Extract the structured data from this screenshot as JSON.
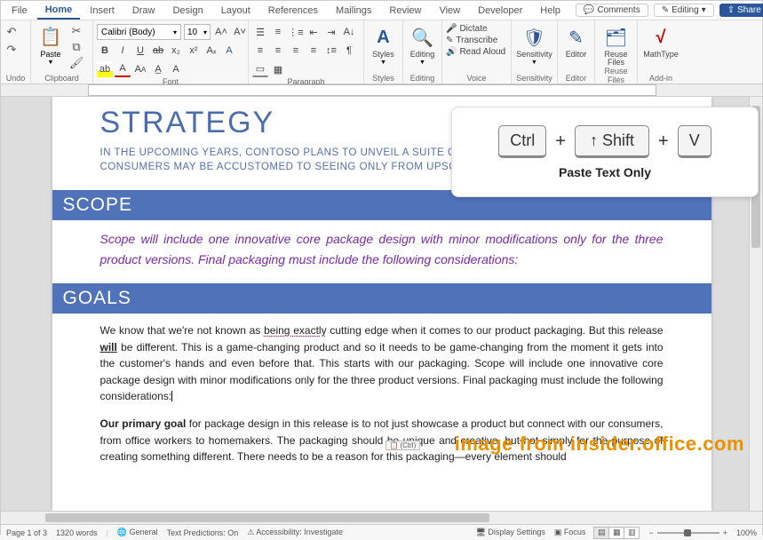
{
  "tabs": {
    "file": "File",
    "home": "Home",
    "insert": "Insert",
    "draw": "Draw",
    "design": "Design",
    "layout": "Layout",
    "references": "References",
    "mailings": "Mailings",
    "review": "Review",
    "view": "View",
    "developer": "Developer",
    "help": "Help"
  },
  "actions": {
    "comments": "Comments",
    "editing": "Editing",
    "share": "Share"
  },
  "ribbon": {
    "undo_label": "Undo",
    "clipboard_label": "Clipboard",
    "paste_label": "Paste",
    "font_label": "Font",
    "font_name": "Calibri (Body)",
    "font_size": "10",
    "paragraph_label": "Paragraph",
    "styles_label": "Styles",
    "styles_btn": "Styles",
    "editing_label": "Editing",
    "editing_btn": "Editing",
    "voice_label": "Voice",
    "dictate": "Dictate",
    "transcribe": "Transcribe",
    "read_aloud": "Read Aloud",
    "sensitivity_label": "Sensitivity",
    "sensitivity_btn": "Sensitivity",
    "editor_label": "Editor",
    "editor_btn": "Editor",
    "reuse_label": "Reuse Files",
    "reuse_btn": "Reuse\nFiles",
    "addin_label": "Add-in",
    "mathtype": "MathType"
  },
  "doc": {
    "h1": "STRATEGY",
    "sub": "IN THE UPCOMING YEARS, CONTOSO PLANS TO UNVEIL A SUITE OF HIGH-QUALITY PRODUCTS THAT CONSUMERS MAY BE ACCUSTOMED TO SEEING ONLY FROM UPSCALE ELECTRONICS MANUFACTURERS.",
    "scope_h": "SCOPE",
    "scope_p": "Scope will include one innovative core package design with minor modifications only for the three product versions. Final packaging must include the following considerations:",
    "goals_h": "GOALS",
    "goals_p1_a": "We know that we're not known as ",
    "goals_p1_spell": "being exactly",
    "goals_p1_b": " cutting edge when it comes to our product packaging. But this release ",
    "goals_p1_will": "will",
    "goals_p1_c": " be different. This is a game-changing product and so it needs to be game-changing from the moment it gets into the customer's hands and even before that. This starts with our packaging. Scope will include one innovative core package design with minor modifications only for the three product versions. Final packaging must include the following considerations:",
    "goals_p2_bold": "Our primary goal",
    "goals_p2_rest": " for package design in this release is to not just showcase a product but connect with our consumers, from office workers to homemakers. The packaging should be unique and creative, but not simply for the purpose of creating something different. There needs to be a reason for this packaging—every element should",
    "paste_badge": "(Ctrl)"
  },
  "callout": {
    "ctrl": "Ctrl",
    "shift": "Shift",
    "v": "V",
    "plus": "+",
    "label": "Paste Text Only"
  },
  "status": {
    "page": "Page 1 of 3",
    "words": "1320 words",
    "lang": "General",
    "predictions": "Text Predictions: On",
    "accessibility": "Accessibility: Investigate",
    "display": "Display Settings",
    "focus": "Focus",
    "zoom": "100%"
  },
  "watermark": "image from insider.office.com"
}
